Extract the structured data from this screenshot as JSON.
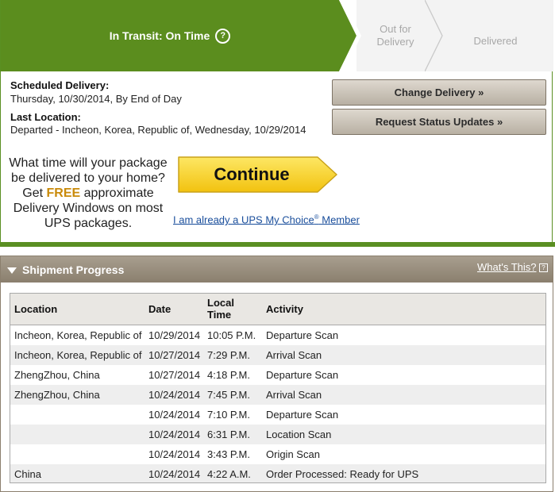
{
  "progress": {
    "current_step": "In Transit: On Time",
    "step2_line1": "Out for",
    "step2_line2": "Delivery",
    "step3": "Delivered",
    "info_symbol": "?"
  },
  "delivery": {
    "scheduled_label": "Scheduled Delivery:",
    "scheduled_value": "Thursday, 10/30/2014, By End of Day",
    "last_location_label": "Last Location:",
    "last_location_value": "Departed - Incheon, Korea, Republic of, Wednesday, 10/29/2014"
  },
  "actions": {
    "change_delivery": "Change Delivery »",
    "request_status": "Request Status Updates »"
  },
  "promo": {
    "line1": "What time will your package",
    "line2": "be delivered to your home?",
    "line3_pre": "Get ",
    "line3_free": "FREE",
    "line3_post": " approximate",
    "line4": "Delivery Windows on most",
    "line5": "UPS packages.",
    "continue_label": "Continue",
    "mychoice_pre": "I am already a UPS My Choice",
    "mychoice_reg": "®",
    "mychoice_post": " Member"
  },
  "shipment_progress": {
    "title": "Shipment Progress",
    "whats_this": "What's This?",
    "help_symbol": "?",
    "headers": {
      "location": "Location",
      "date": "Date",
      "local_time_1": "Local",
      "local_time_2": "Time",
      "activity": "Activity"
    },
    "rows": [
      {
        "location": "Incheon, Korea, Republic of",
        "date": "10/29/2014",
        "time": "10:05 P.M.",
        "activity": "Departure Scan"
      },
      {
        "location": "Incheon, Korea, Republic of",
        "date": "10/27/2014",
        "time": "7:29 P.M.",
        "activity": "Arrival Scan"
      },
      {
        "location": "ZhengZhou, China",
        "date": "10/27/2014",
        "time": "4:18 P.M.",
        "activity": "Departure Scan"
      },
      {
        "location": "ZhengZhou, China",
        "date": "10/24/2014",
        "time": "7:45 P.M.",
        "activity": "Arrival Scan"
      },
      {
        "location": "",
        "date": "10/24/2014",
        "time": "7:10 P.M.",
        "activity": "Departure Scan"
      },
      {
        "location": "",
        "date": "10/24/2014",
        "time": "6:31 P.M.",
        "activity": "Location Scan"
      },
      {
        "location": "",
        "date": "10/24/2014",
        "time": "3:43 P.M.",
        "activity": "Origin Scan"
      },
      {
        "location": "China",
        "date": "10/24/2014",
        "time": "4:22 A.M.",
        "activity": "Order Processed: Ready for UPS"
      }
    ]
  },
  "colors": {
    "ups_green": "#5b8d1e",
    "brown_header": "#8a7f6e",
    "continue_yellow": "#f7cf1b",
    "free_orange": "#c98a0a",
    "link_blue": "#1b4f9c"
  }
}
